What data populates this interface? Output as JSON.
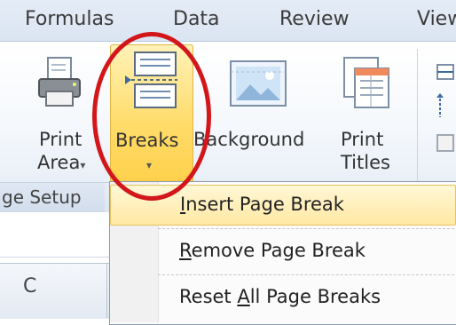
{
  "tabs": [
    {
      "label": "Formulas"
    },
    {
      "label": "Data"
    },
    {
      "label": "Review"
    },
    {
      "label": "View"
    }
  ],
  "ribbon": {
    "print_area": {
      "line1": "Print",
      "line2": "Area",
      "caret": "▾"
    },
    "breaks": {
      "label": "Breaks",
      "caret": "▾"
    },
    "background": {
      "label": "Background"
    },
    "print_titles": {
      "line1": "Print",
      "line2": "Titles"
    },
    "group_label": "ge Setup"
  },
  "menu": {
    "items": [
      {
        "pre": "",
        "accel": "I",
        "post": "nsert Page Break"
      },
      {
        "pre": "",
        "accel": "R",
        "post": "emove Page Break"
      },
      {
        "pre": "Reset ",
        "accel": "A",
        "post": "ll Page Breaks"
      }
    ]
  },
  "sheet": {
    "column_label": "C"
  },
  "colors": {
    "highlight": "#ffd04a",
    "annotation_circle": "#d2161a",
    "tab_bar": "#dbe5f2"
  }
}
